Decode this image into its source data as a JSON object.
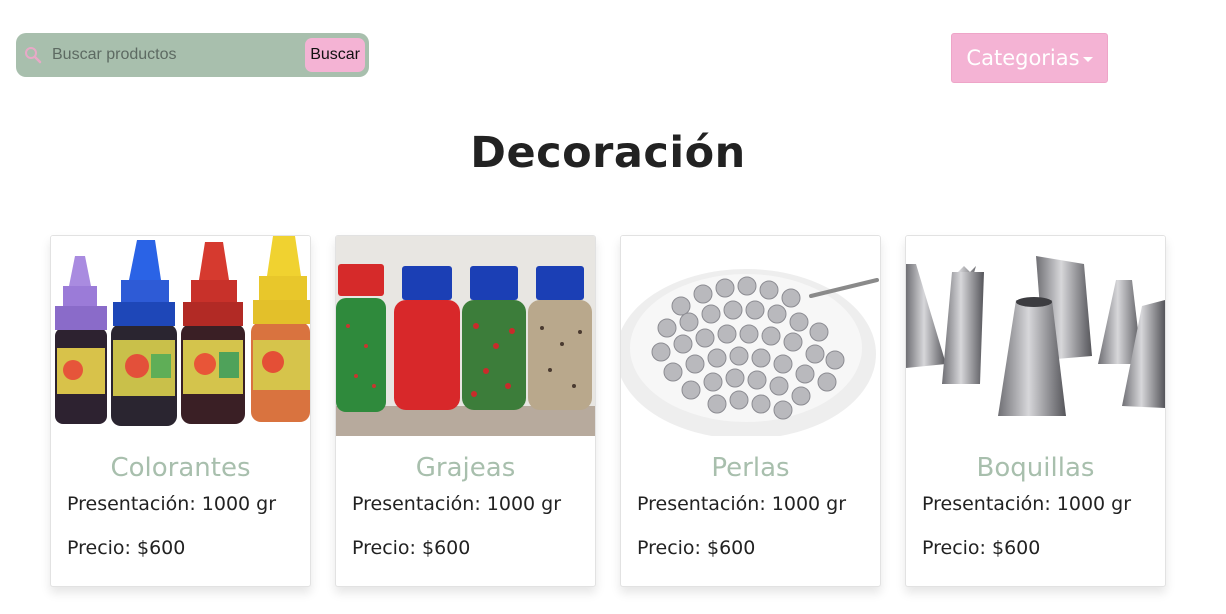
{
  "search": {
    "placeholder": "Buscar productos",
    "value": "",
    "button_label": "Buscar"
  },
  "categories_button": {
    "label": "Categorias"
  },
  "page_title": "Decoración",
  "products": [
    {
      "name": "Colorantes",
      "presentation": "Presentación: 1000 gr",
      "price": "Precio: $600",
      "image": "colorant-bottles-image"
    },
    {
      "name": "Grajeas",
      "presentation": "Presentación: 1000 gr",
      "price": "Precio: $600",
      "image": "sprinkle-bottles-image"
    },
    {
      "name": "Perlas",
      "presentation": "Presentación: 1000 gr",
      "price": "Precio: $600",
      "image": "silver-pearls-image"
    },
    {
      "name": "Boquillas",
      "presentation": "Presentación: 1000 gr",
      "price": "Precio: $600",
      "image": "piping-tips-image"
    }
  ],
  "colors": {
    "sage": "#a8bfad",
    "pink": "#f4b3d4"
  }
}
